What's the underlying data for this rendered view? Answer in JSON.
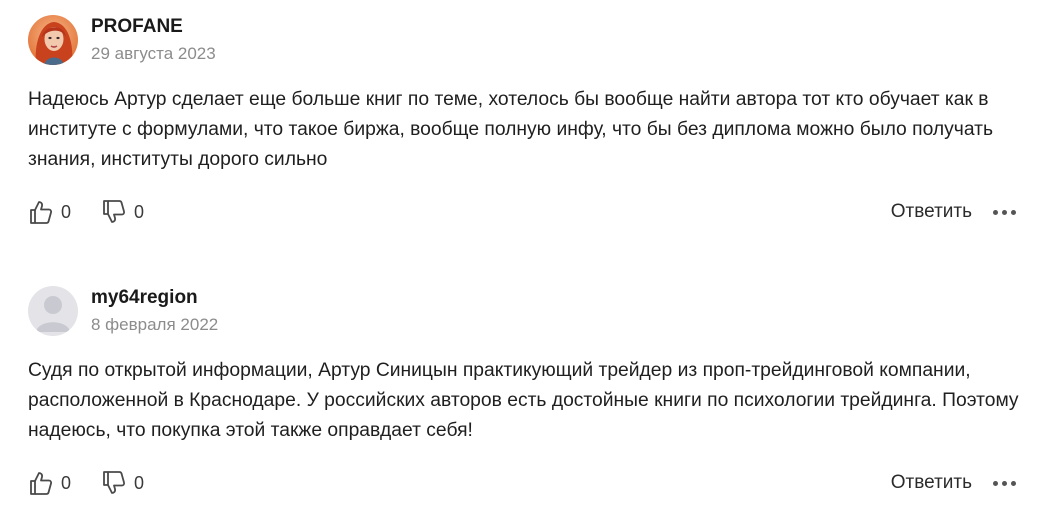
{
  "comments": [
    {
      "author": "PROFANE",
      "date": "29 августа 2023",
      "text": "Надеюсь Артур сделает еще больше книг по теме, хотелось бы вообще найти автора тот кто обучает как в институте с формулами, что такое биржа, вообще полную инфу, что бы без диплома можно было получать знания, институты дорого сильно",
      "likes": "0",
      "dislikes": "0",
      "reply_label": "Ответить",
      "avatar": "photo-avatar"
    },
    {
      "author": "my64region",
      "date": "8 февраля 2022",
      "text": "Судя по открытой информации, Артур Синицын практикующий трейдер из проп-трейдинговой компании, расположенной в Краснодаре. У российских авторов есть достойные книги по психологии трейдинга. Поэтому надеюсь, что покупка этой также оправдает себя!",
      "likes": "0",
      "dislikes": "0",
      "reply_label": "Ответить",
      "avatar": "default-avatar"
    }
  ],
  "icons": {
    "like": "thumb-up-icon",
    "dislike": "thumb-down-icon",
    "more": "more-dots-icon"
  },
  "colors": {
    "text": "#1f1f1f",
    "date": "#8c8c8c",
    "icon": "#4a4a4a",
    "default_avatar_bg": "#e3e3e8"
  }
}
